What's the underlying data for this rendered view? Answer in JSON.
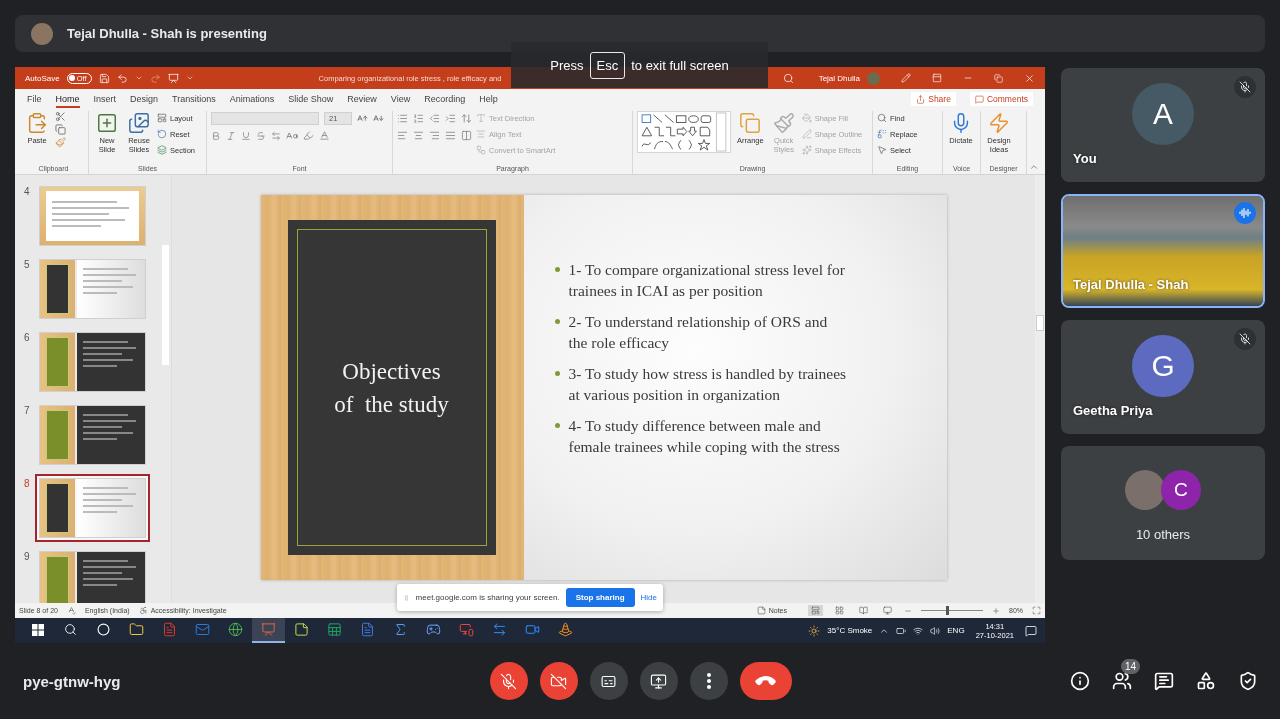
{
  "meeting": {
    "presenter_banner": "Tejal Dhulla - Shah is presenting",
    "code": "pye-gtnw-hyg"
  },
  "fullscreen_hint": {
    "before": "Press",
    "key": "Esc",
    "after": "to exit full screen"
  },
  "powerpoint": {
    "autosave_label": "AutoSave",
    "autosave": {
      "label": "Off",
      "on": false
    },
    "title": "Comparing organizational role stress , role efficacy and",
    "user": "Tejal Dhulla",
    "tabs": [
      {
        "label": "File",
        "selected": false
      },
      {
        "label": "Home",
        "selected": true
      },
      {
        "label": "Insert",
        "selected": false
      },
      {
        "label": "Design",
        "selected": false
      },
      {
        "label": "Transitions",
        "selected": false
      },
      {
        "label": "Animations",
        "selected": false
      },
      {
        "label": "Slide Show",
        "selected": false
      },
      {
        "label": "Review",
        "selected": false
      },
      {
        "label": "View",
        "selected": false
      },
      {
        "label": "Recording",
        "selected": false
      },
      {
        "label": "Help",
        "selected": false
      }
    ],
    "share": "Share",
    "comments": "Comments",
    "ribbon": {
      "clipboard": {
        "paste": "Paste",
        "label": "Clipboard"
      },
      "slides": {
        "new_slide": "New Slide",
        "reuse_slides": "Reuse Slides",
        "layout": "Layout",
        "reset": "Reset",
        "section": "Section",
        "label": "Slides"
      },
      "font": {
        "size": "21",
        "label": "Font"
      },
      "paragraph": {
        "items": [
          {
            "label": "Text Direction",
            "disabled": true
          },
          {
            "label": "Align Text",
            "disabled": true
          },
          {
            "label": "Convert to SmartArt",
            "disabled": true
          }
        ],
        "label": "Paragraph"
      },
      "drawing": {
        "arrange": "Arrange",
        "quick_styles": {
          "label": "Quick Styles",
          "disabled": true
        },
        "items": [
          {
            "label": "Shape Fill",
            "disabled": true
          },
          {
            "label": "Shape Outline",
            "disabled": true
          },
          {
            "label": "Shape Effects",
            "disabled": true
          }
        ],
        "label": "Drawing"
      },
      "editing": {
        "find": "Find",
        "replace": "Replace",
        "select": "Select",
        "label": "Editing"
      },
      "voice": {
        "dictate": "Dictate",
        "label": "Voice"
      },
      "designer": {
        "design_ideas": "Design Ideas",
        "label": "Designer"
      }
    },
    "thumbnails": [
      {
        "number": "4",
        "kind": "light",
        "selected": false
      },
      {
        "number": "5",
        "kind": "dark-card",
        "selected": false
      },
      {
        "number": "6",
        "kind": "green-card",
        "selected": false
      },
      {
        "number": "7",
        "kind": "green-card",
        "selected": false
      },
      {
        "number": "8",
        "kind": "dark-card",
        "selected": true
      },
      {
        "number": "9",
        "kind": "green-card",
        "selected": false
      }
    ],
    "slide": {
      "title_lines": [
        "Objectives",
        "of  the study"
      ],
      "bullets": [
        "1- To compare organizational stress level for\ntrainees in ICAI as per position",
        "2- To understand relationship of ORS and\nthe role efficacy",
        "3- To study how stress is handled by trainees\nat various position in organization",
        "4- To study difference between male and\nfemale trainees while coping with the stress"
      ]
    },
    "status": {
      "slide": "Slide 8 of 20",
      "language": "English (India)",
      "accessibility": "Accessibility: Investigate",
      "notes": "Notes",
      "views": [
        {
          "selected": true
        },
        {
          "selected": false
        },
        {
          "selected": false
        },
        {
          "selected": false
        }
      ],
      "zoom": {
        "level": 0.42
      },
      "zoom_percent": "80%"
    }
  },
  "share_banner": {
    "message": "meet.google.com is sharing your screen.",
    "stop": "Stop sharing",
    "hide": "Hide"
  },
  "taskbar": {
    "apps": [
      {
        "kind": "start",
        "selected": false
      },
      {
        "kind": "search",
        "selected": false
      },
      {
        "kind": "task-view",
        "selected": false
      },
      {
        "kind": "folder",
        "selected": false
      },
      {
        "kind": "document",
        "selected": false
      },
      {
        "kind": "mail",
        "selected": false
      },
      {
        "kind": "browser",
        "selected": false
      },
      {
        "kind": "slides",
        "selected": true
      },
      {
        "kind": "notes",
        "selected": false
      },
      {
        "kind": "sheet",
        "selected": false
      },
      {
        "kind": "text",
        "selected": false
      },
      {
        "kind": "sigma",
        "selected": false
      },
      {
        "kind": "game",
        "selected": false
      },
      {
        "kind": "remote",
        "selected": false
      },
      {
        "kind": "share",
        "selected": false
      },
      {
        "kind": "video",
        "selected": false
      },
      {
        "kind": "cone",
        "selected": false
      }
    ],
    "weather": "35°C Smoke",
    "language": "ENG",
    "time": "14:31",
    "date": "27-10-2021"
  },
  "tiles": [
    {
      "kind": "avatar",
      "initial": "A",
      "color": "#455a64",
      "name": "You",
      "muted": true
    },
    {
      "kind": "video",
      "name": "Tejal Dhulla - Shah",
      "speaking": true
    },
    {
      "kind": "avatar",
      "initial": "G",
      "color": "#5c6bc0",
      "name": "Geetha Priya",
      "muted": true
    },
    {
      "kind": "group",
      "initial": "C",
      "color": "#8e24aa",
      "name": "10 others"
    }
  ],
  "controls": [
    {
      "kind": "mic",
      "on": false
    },
    {
      "kind": "camera",
      "on": false
    },
    {
      "kind": "captions"
    },
    {
      "kind": "present"
    },
    {
      "kind": "more"
    },
    {
      "kind": "leave"
    }
  ],
  "side_actions": [
    {
      "kind": "info"
    },
    {
      "kind": "people",
      "badge": "14"
    },
    {
      "kind": "chat"
    },
    {
      "kind": "activities"
    },
    {
      "kind": "host-controls"
    }
  ]
}
